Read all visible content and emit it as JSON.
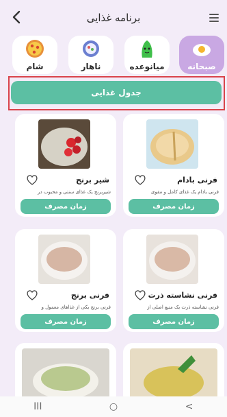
{
  "header": {
    "title": "برنامه غذایی"
  },
  "tabs": [
    {
      "label": "صبحانه",
      "icon": "egg-icon",
      "active": true
    },
    {
      "label": "میانوعده",
      "icon": "vegetable-icon",
      "active": false
    },
    {
      "label": "ناهار",
      "icon": "plate-icon",
      "active": false
    },
    {
      "label": "شام",
      "icon": "pizza-icon",
      "active": false
    }
  ],
  "schedule_button": {
    "label": "جدول غذایی"
  },
  "cards": [
    {
      "name": "فرنی بادام",
      "desc": "فرنی بادام یک غذای کامل و مقوی",
      "button": "زمان مصرف"
    },
    {
      "name": "شیر برنج",
      "desc": "شیربرنج یک غذای سنتی و محبوب در",
      "button": "زمان مصرف"
    },
    {
      "name": "فرنی نشاسته ذرت",
      "desc": "فرنی نشاسته ذرت یک منبع اصلی از",
      "button": "زمان مصرف"
    },
    {
      "name": "فرنی برنج",
      "desc": "فرنی برنج یکی از غذاهای معمول و",
      "button": "زمان مصرف"
    }
  ],
  "colors": {
    "accent": "#5cbfa3",
    "active_tab": "#c9a8e3",
    "background": "#f3ecf8",
    "highlight": "#d9434b"
  },
  "navbar": {
    "recents": "III",
    "home": "○",
    "back": "<"
  }
}
